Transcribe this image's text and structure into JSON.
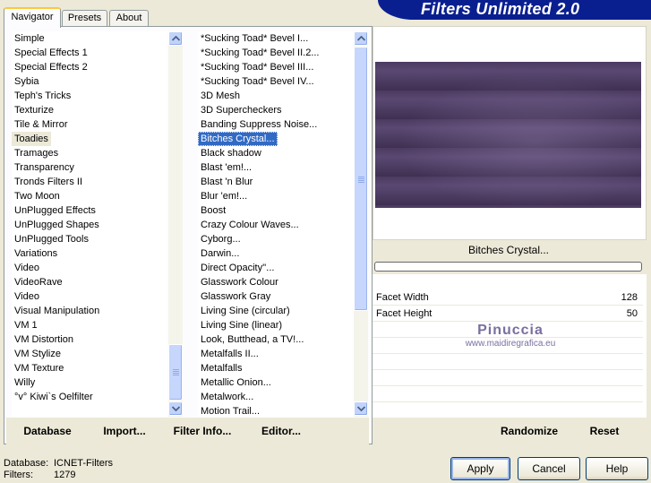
{
  "brand": {
    "title": "Filters Unlimited 2.0"
  },
  "tabs": [
    {
      "label": "Navigator",
      "active": true
    },
    {
      "label": "Presets",
      "active": false
    },
    {
      "label": "About",
      "active": false
    }
  ],
  "categories": {
    "items": [
      "Simple",
      "Special Effects 1",
      "Special Effects 2",
      "Sybia",
      "Teph's Tricks",
      "Texturize",
      "Tile & Mirror",
      "Toadies",
      "Tramages",
      "Transparency",
      "Tronds Filters II",
      "Two Moon",
      "UnPlugged Effects",
      "UnPlugged Shapes",
      "UnPlugged Tools",
      "Variations",
      "Video",
      "VideoRave",
      "Video",
      "Visual Manipulation",
      "VM 1",
      "VM Distortion",
      "VM Stylize",
      "VM Texture",
      "Willy",
      "°v° Kiwi`s Oelfilter"
    ],
    "selected": "Toadies"
  },
  "filters": {
    "items": [
      "*Sucking Toad*  Bevel I...",
      "*Sucking Toad*  Bevel II.2...",
      "*Sucking Toad*  Bevel III...",
      "*Sucking Toad*  Bevel IV...",
      "3D Mesh",
      "3D Supercheckers",
      "Banding Suppress Noise...",
      "Bitches Crystal...",
      "Black shadow",
      "Blast 'em!...",
      "Blast 'n Blur",
      "Blur 'em!...",
      "Boost",
      "Crazy Colour Waves...",
      "Cyborg...",
      "Darwin...",
      "Direct Opacity''...",
      "Glasswork Colour",
      "Glasswork Gray",
      "Living Sine (circular)",
      "Living Sine (linear)",
      "Look, Butthead, a TV!...",
      "Metalfalls II...",
      "Metalfalls",
      "Metallic Onion...",
      "Metalwork...",
      "Motion Trail..."
    ],
    "selected": "Bitches Crystal..."
  },
  "left_buttons": {
    "database": "Database",
    "import": "Import...",
    "filter_info": "Filter Info...",
    "editor": "Editor..."
  },
  "right_buttons": {
    "randomize": "Randomize",
    "reset": "Reset"
  },
  "preview": {
    "filter_name": "Bitches Crystal...",
    "progress": 0
  },
  "controls": [
    {
      "label": "Facet Width",
      "value": "128"
    },
    {
      "label": "Facet Height",
      "value": "50"
    }
  ],
  "watermark": {
    "line1": "Pinuccia",
    "line2": "www.maidiregrafica.eu"
  },
  "footer": {
    "database_label": "Database:",
    "database_value": "ICNET-Filters",
    "filters_label": "Filters:",
    "filters_value": "1279"
  },
  "dialog_buttons": {
    "apply": "Apply",
    "cancel": "Cancel",
    "help": "Help"
  },
  "colors": {
    "brand": "#0a1f8f",
    "selection": "#316ac5",
    "tab_highlight": "#ffc83c",
    "preview": "#4a3a5e"
  }
}
